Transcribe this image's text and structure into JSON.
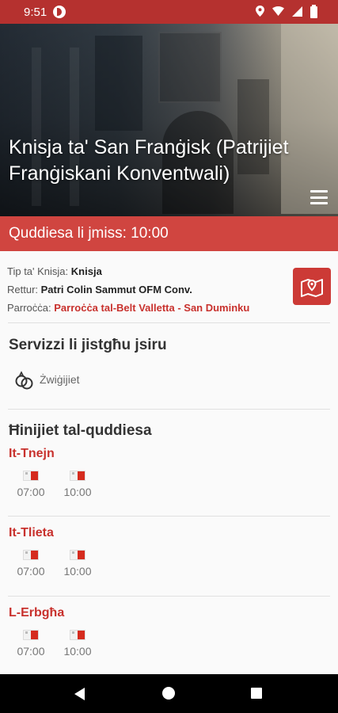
{
  "status_bar": {
    "time": "9:51"
  },
  "header": {
    "title": "Knisja ta' San Franġisk (Patrijiet Franġiskani Konventwali)"
  },
  "next_mass": {
    "text": "Quddiesa li jmiss: 10:00"
  },
  "info": {
    "type_label": "Tip ta' Knisja:",
    "type_value": "Knisja",
    "rector_label": "Rettur:",
    "rector_value": "Patri Colin Sammut OFM Conv.",
    "parish_label": "Parroċċa:",
    "parish_value": "Parroċċa tal-Belt Valletta - San Duminku"
  },
  "services": {
    "title": "Servizzi li jistgħu jsiru",
    "items": [
      {
        "label": "Żwiġijiet",
        "icon": "rings-icon"
      }
    ]
  },
  "schedule": {
    "title": "Ħinijiet tal-quddiesa",
    "days": [
      {
        "name": "It-Tnejn",
        "times": [
          "07:00",
          "10:00"
        ]
      },
      {
        "name": "It-Tlieta",
        "times": [
          "07:00",
          "10:00"
        ]
      },
      {
        "name": "L-Erbgħa",
        "times": [
          "07:00",
          "10:00"
        ]
      }
    ]
  },
  "colors": {
    "status_bar": "#b5312f",
    "banner": "#d04540",
    "accent": "#c8312d"
  }
}
